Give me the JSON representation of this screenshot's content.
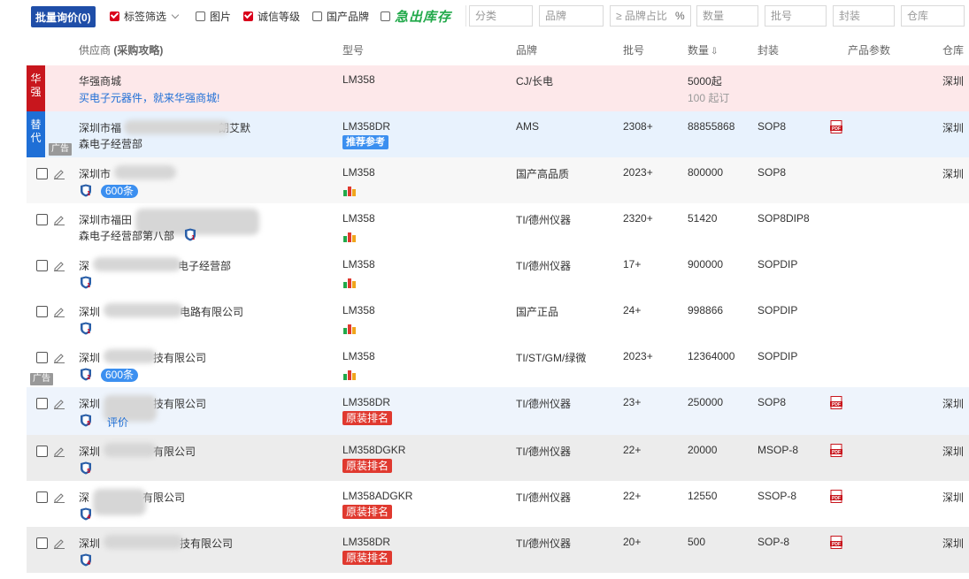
{
  "filterbar": {
    "batch_button": "批量询价(0)",
    "tag_filter": "标签筛选",
    "image_label": "图片",
    "credit_label": "诚信等级",
    "domestic_label": "国产品牌",
    "express_stock": "急出库存",
    "category_placeholder": "分类",
    "brand_placeholder": "品牌",
    "brand_ratio_placeholder": "≥ 品牌占比",
    "brand_ratio_suffix": "%",
    "qty_placeholder": "数量",
    "batch_placeholder": "批号",
    "package_placeholder": "封装",
    "warehouse_placeholder": "仓库"
  },
  "table": {
    "headers": {
      "supplier": "供应商",
      "purchase_guide": "(采购攻略)",
      "model": "型号",
      "brand": "品牌",
      "batch": "批号",
      "qty": "数量",
      "qty_sort_icon": "⇩",
      "package": "封装",
      "params": "产品参数",
      "warehouse": "仓库"
    },
    "huaqiang": {
      "tag": "华强",
      "name": "华强商城",
      "slogan": "买电子元器件，就来华强商城!",
      "model": "LM358",
      "brand": "CJ/长电",
      "qty": "5000起",
      "qty_sub": "100 起订",
      "warehouse": "深圳"
    },
    "substitute": {
      "tag": "替代",
      "ad": "广告",
      "name_a": "深圳市福",
      "name_b": "朗艾默",
      "name_line2": "森电子经营部",
      "model": "LM358DR",
      "badge": "推荐参考",
      "brand": "AMS",
      "batch": "2308+",
      "qty": "88855868",
      "package": "SOP8",
      "warehouse": "深圳"
    },
    "rows": [
      {
        "name_a": "深圳市",
        "name_b": "",
        "name_line2": "",
        "pill": "600条",
        "model": "LM358",
        "badge": "",
        "brand": "国产高品质",
        "batch": "2023+",
        "qty": "800000",
        "package": "SOP8",
        "pdf": false,
        "warehouse": "深圳",
        "shield": "1",
        "ad": ""
      },
      {
        "name_a": "深圳市福田",
        "name_b": "",
        "name_line2": "森电子经营部第八部",
        "pill": "",
        "model": "LM358",
        "badge": "",
        "brand": "TI/德州仪器",
        "batch": "2320+",
        "qty": "51420",
        "package": "SOP8DIP8",
        "pdf": false,
        "warehouse": "",
        "shield": "1",
        "ad": ""
      },
      {
        "name_a": "深",
        "name_b": "电子经营部",
        "name_line2": "",
        "pill": "",
        "model": "LM358",
        "badge": "",
        "brand": "TI/德州仪器",
        "batch": "17+",
        "qty": "900000",
        "package": "SOPDIP",
        "pdf": false,
        "warehouse": "",
        "shield": "1",
        "ad": ""
      },
      {
        "name_a": "深圳",
        "name_b": "电路有限公司",
        "name_line2": "",
        "pill": "",
        "model": "LM358",
        "badge": "",
        "brand": "国产正品",
        "batch": "24+",
        "qty": "998866",
        "package": "SOPDIP",
        "pdf": false,
        "warehouse": "",
        "shield": "1",
        "ad": ""
      },
      {
        "name_a": "深圳",
        "name_b": "技有限公司",
        "name_line2": "",
        "pill": "600条",
        "model": "LM358",
        "badge": "",
        "brand": "TI/ST/GM/绿微",
        "batch": "2023+",
        "qty": "12364000",
        "package": "SOPDIP",
        "pdf": false,
        "warehouse": "",
        "shield": "2",
        "ad": "广告"
      },
      {
        "name_a": "深圳",
        "name_b": "技有限公司",
        "name_line2": "",
        "pill": "",
        "eval": "评价",
        "model": "LM358DR",
        "badge": "原装排名",
        "brand": "TI/德州仪器",
        "batch": "23+",
        "qty": "250000",
        "package": "SOP8",
        "pdf": true,
        "warehouse": "深圳",
        "shield": "5",
        "ad": ""
      },
      {
        "name_a": "深圳",
        "name_b": "有限公司",
        "name_line2": "",
        "pill": "",
        "model": "LM358DGKR",
        "badge": "原装排名",
        "brand": "TI/德州仪器",
        "batch": "22+",
        "qty": "20000",
        "package": "MSOP-8",
        "pdf": true,
        "warehouse": "深圳",
        "shield": "5",
        "ad": ""
      },
      {
        "name_a": "深",
        "name_b": "有限公司",
        "name_line2": "",
        "pill": "",
        "model": "LM358ADGKR",
        "badge": "原装排名",
        "brand": "TI/德州仪器",
        "batch": "22+",
        "qty": "12550",
        "package": "SSOP-8",
        "pdf": true,
        "warehouse": "深圳",
        "shield": "4",
        "ad": ""
      },
      {
        "name_a": "深圳",
        "name_b": "技有限公司",
        "name_line2": "",
        "pill": "",
        "model": "LM358DR",
        "badge": "原装排名",
        "brand": "TI/德州仪器",
        "batch": "20+",
        "qty": "500",
        "package": "SOP-8",
        "pdf": true,
        "warehouse": "深圳",
        "shield": "4",
        "ad": ""
      }
    ]
  },
  "colors": {
    "brand_blue": "#1f4ea8",
    "huaqiang_red": "#d9001b",
    "substitute_blue": "#1f6fd6",
    "badge_red": "#e0392f",
    "express_green": "#21a94a"
  }
}
